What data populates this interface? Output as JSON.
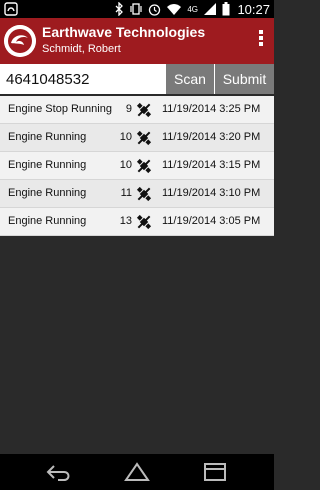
{
  "status_bar": {
    "time": "10:27",
    "network": "4G",
    "icons": [
      "app-notification-icon",
      "bluetooth-icon",
      "vibrate-icon",
      "alarm-icon",
      "wifi-icon",
      "signal-icon",
      "battery-icon"
    ]
  },
  "app_bar": {
    "title": "Earthwave Technologies",
    "subtitle": "Schmidt, Robert",
    "brand_color": "#9e1b1f"
  },
  "input": {
    "value": "4641048532"
  },
  "buttons": {
    "scan": "Scan",
    "submit": "Submit"
  },
  "events": [
    {
      "label": "Engine Stop Running",
      "count": "9",
      "timestamp": "11/19/2014 3:25 PM",
      "icon": "satellite-icon"
    },
    {
      "label": "Engine Running",
      "count": "10",
      "timestamp": "11/19/2014 3:20 PM",
      "icon": "satellite-icon"
    },
    {
      "label": "Engine Running",
      "count": "10",
      "timestamp": "11/19/2014 3:15 PM",
      "icon": "satellite-icon"
    },
    {
      "label": "Engine Running",
      "count": "11",
      "timestamp": "11/19/2014 3:10 PM",
      "icon": "satellite-icon"
    },
    {
      "label": "Engine Running",
      "count": "13",
      "timestamp": "11/19/2014 3:05 PM",
      "icon": "satellite-icon"
    }
  ],
  "nav_bar": {
    "icons": [
      "back-icon",
      "home-icon",
      "recents-icon"
    ]
  }
}
